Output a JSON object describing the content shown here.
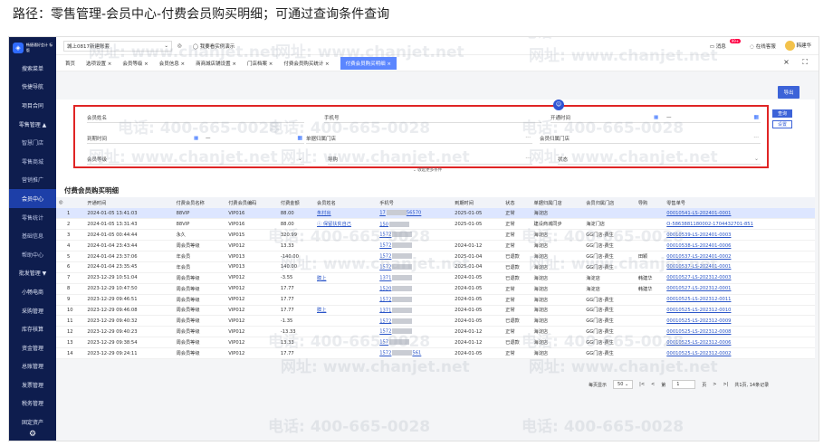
{
  "caption": "路径：零售管理-会员中心-付费会员购买明细；可通过查询条件查询",
  "logo_text": "畅捷通好会计 标版",
  "sidebar": {
    "items": [
      {
        "label": "搜索菜单"
      },
      {
        "label": "快捷导航"
      },
      {
        "label": "项目合同"
      },
      {
        "label": "零售管理 ▲"
      },
      {
        "label": "智慧门店"
      },
      {
        "label": "零售商城"
      },
      {
        "label": "营销推广"
      },
      {
        "label": "会员中心"
      },
      {
        "label": "零售统计"
      },
      {
        "label": "基础信息"
      },
      {
        "label": "帮助中心"
      },
      {
        "label": "批发管理 ▼"
      },
      {
        "label": "小畅电商"
      },
      {
        "label": "采购管理"
      },
      {
        "label": "库存核算"
      },
      {
        "label": "资金管理"
      },
      {
        "label": "总账管理"
      },
      {
        "label": "发票管理"
      },
      {
        "label": "税务管理"
      },
      {
        "label": "固定资产"
      }
    ]
  },
  "topbar": {
    "store": "城上0817新建账套",
    "guide": "我要看实例演示",
    "messages": "消息",
    "message_count": "99+",
    "service": "在线客服",
    "user": "韩建华"
  },
  "tabs": [
    "首页",
    "选项设置 ×",
    "会员等级 ×",
    "会员信息 ×",
    "商商城店铺设置 ×",
    "门店档案 ×",
    "付费会员购买统计 ×",
    "付费会员购买明细 ×"
  ],
  "export_label": "导出",
  "filters": {
    "member_name": "会员姓名",
    "phone": "手机号",
    "open_time": "开通时间",
    "expire_time": "到期时间",
    "dash": "—",
    "sale_store": "单据归属门店",
    "member_store": "会员归属门店",
    "member_level": "会员等级",
    "guide": "导购",
    "status": "状态",
    "query": "查询",
    "settings": "设置",
    "expand": "⌄ 收起更多条件"
  },
  "section_title": "付费会员购买明细",
  "table": {
    "headers": [
      "",
      "开通时间",
      "付费会员名称",
      "付费会员编码",
      "付费金额",
      "会员姓名",
      "手机号",
      "到期时间",
      "状态",
      "单据归属门店",
      "会员归属门店",
      "导购",
      "零售单号"
    ],
    "rows": [
      {
        "n": "1",
        "time": "2024-01-05 13:41:03",
        "card": "88VIP",
        "code": "VIP016",
        "amt": "88.00",
        "name": "朱村出",
        "phone_pre": "17",
        "phone_suf": "56570",
        "exp": "2025-01-05",
        "status": "正常",
        "sale": "海淀店",
        "mstore": "",
        "guide": "",
        "order": "00010541-LS-202401-0001"
      },
      {
        "n": "2",
        "time": "2024-01-05 13:31:43",
        "card": "88VIP",
        "code": "VIP016",
        "amt": "88.00",
        "name": "ⓘ 保留扶贫自己",
        "phone_pre": "150",
        "phone_suf": "",
        "exp": "2025-01-05",
        "status": "正常",
        "sale": "建设商城同步",
        "mstore": "海淀门店",
        "guide": "",
        "order": "O-5863881180002-1704432701-851"
      },
      {
        "n": "3",
        "time": "2024-01-05 00:44:44",
        "card": "永久",
        "code": "VIP015",
        "amt": "320.99",
        "name": "",
        "phone_pre": "1572",
        "phone_suf": "",
        "exp": "",
        "status": "正常",
        "sale": "海淀店",
        "mstore": "GG门店-费生",
        "guide": "",
        "order": "00010539-LS-202401-0003"
      },
      {
        "n": "4",
        "time": "2024-01-04 23:43:44",
        "card": "周会员等级",
        "code": "VIP012",
        "amt": "13.33",
        "name": "",
        "phone_pre": "1572",
        "phone_suf": "",
        "exp": "2024-01-12",
        "status": "正常",
        "sale": "海淀店",
        "mstore": "GG门店-费生",
        "guide": "",
        "order": "00010538-LS-202401-0006"
      },
      {
        "n": "5",
        "time": "2024-01-04 23:37:06",
        "card": "年会员",
        "code": "VIP013",
        "amt": "-140.00",
        "name": "",
        "phone_pre": "1572",
        "phone_suf": "",
        "exp": "2025-01-04",
        "status": "已退款",
        "sale": "海淀店",
        "mstore": "GG门店-费生",
        "guide": "田颖",
        "order": "00010537-LS-202401-0002"
      },
      {
        "n": "6",
        "time": "2024-01-04 23:35:45",
        "card": "年会员",
        "code": "VIP013",
        "amt": "140.00",
        "name": "",
        "phone_pre": "1572",
        "phone_suf": "",
        "exp": "2025-01-04",
        "status": "已退款",
        "sale": "海淀店",
        "mstore": "GG门店-费生",
        "guide": "",
        "order": "00010537-LS-202401-0001"
      },
      {
        "n": "7",
        "time": "2023-12-29 10:51:04",
        "card": "周会员等级",
        "code": "VIP012",
        "amt": "-3.55",
        "name": "膜上",
        "phone_pre": "1371",
        "phone_suf": "",
        "exp": "2024-01-05",
        "status": "已退款",
        "sale": "海淀店",
        "mstore": "海淀店",
        "guide": "韩建华",
        "order": "00010527-LS-202312-0003"
      },
      {
        "n": "8",
        "time": "2023-12-29 10:47:50",
        "card": "周会员等级",
        "code": "VIP012",
        "amt": "17.77",
        "name": "",
        "phone_pre": "1520",
        "phone_suf": "",
        "exp": "2024-01-05",
        "status": "正常",
        "sale": "海淀店",
        "mstore": "海淀店",
        "guide": "韩建华",
        "order": "00010527-LS-202312-0001"
      },
      {
        "n": "9",
        "time": "2023-12-29 09:46:51",
        "card": "周会员等级",
        "code": "VIP012",
        "amt": "17.77",
        "name": "",
        "phone_pre": "1572",
        "phone_suf": "",
        "exp": "2024-01-05",
        "status": "正常",
        "sale": "海淀店",
        "mstore": "GG门店-费生",
        "guide": "",
        "order": "00010525-LS-202312-0011"
      },
      {
        "n": "10",
        "time": "2023-12-29 09:46:08",
        "card": "周会员等级",
        "code": "VIP012",
        "amt": "17.77",
        "name": "膜上",
        "phone_pre": "1371",
        "phone_suf": "",
        "exp": "2024-01-05",
        "status": "正常",
        "sale": "海淀店",
        "mstore": "GG门店-费生",
        "guide": "",
        "order": "00010525-LS-202312-0010"
      },
      {
        "n": "11",
        "time": "2023-12-29 09:40:32",
        "card": "周会员等级",
        "code": "VIP012",
        "amt": "-1.35",
        "name": "",
        "phone_pre": "1572",
        "phone_suf": "",
        "exp": "2024-01-05",
        "status": "已退款",
        "sale": "海淀店",
        "mstore": "GG门店-费生",
        "guide": "",
        "order": "00010525-LS-202312-0009"
      },
      {
        "n": "12",
        "time": "2023-12-29 09:40:23",
        "card": "周会员等级",
        "code": "VIP012",
        "amt": "-13.33",
        "name": "",
        "phone_pre": "1572",
        "phone_suf": "",
        "exp": "2024-01-12",
        "status": "正常",
        "sale": "海淀店",
        "mstore": "GG门店-费生",
        "guide": "",
        "order": "00010525-LS-202312-0008"
      },
      {
        "n": "13",
        "time": "2023-12-29 09:38:54",
        "card": "周会员等级",
        "code": "VIP012",
        "amt": "13.33",
        "name": "",
        "phone_pre": "157",
        "phone_suf": "",
        "exp": "2024-01-12",
        "status": "已退款",
        "sale": "海淀店",
        "mstore": "GG门店-费生",
        "guide": "",
        "order": "00010525-LS-202312-0006"
      },
      {
        "n": "14",
        "time": "2023-12-29 09:24:11",
        "card": "周会员等级",
        "code": "VIP012",
        "amt": "17.77",
        "name": "",
        "phone_pre": "1572",
        "phone_suf": "561",
        "exp": "2024-01-05",
        "status": "正常",
        "sale": "海淀店",
        "mstore": "GG门店-费生",
        "guide": "",
        "order": "00010525-LS-202312-0002"
      }
    ]
  },
  "pager": {
    "per_page_label": "每页显示",
    "per_page": "50",
    "first": "|<",
    "prev": "<",
    "page_label": "第",
    "page": "1",
    "page_suffix": "页",
    "next": ">",
    "last": ">|",
    "total": "共1页, 14条记录"
  },
  "watermarks": {
    "phone": "电话: 400-665-0028",
    "site": "网址: www.chanjet.net"
  }
}
